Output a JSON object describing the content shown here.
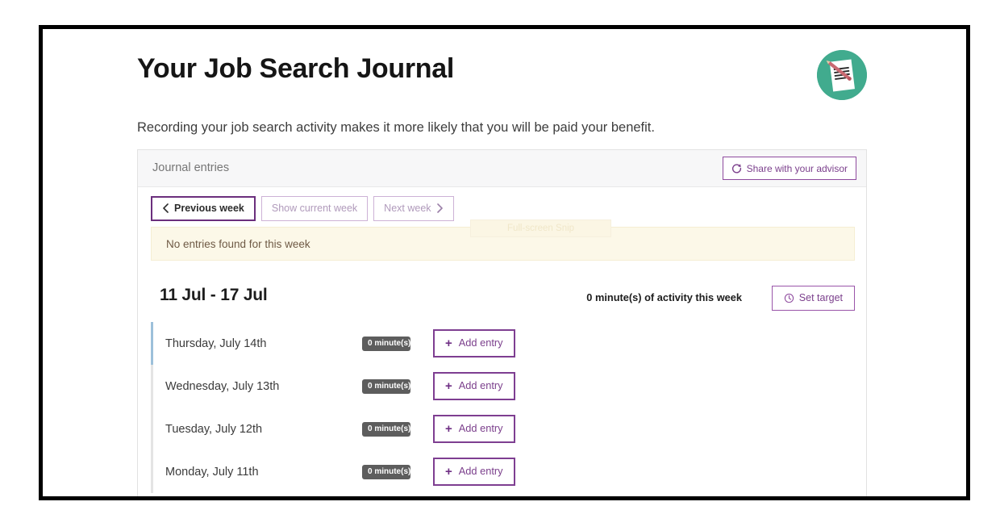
{
  "page": {
    "title": "Your Job Search Journal",
    "intro": "Recording your job search activity makes it more likely that you will be paid your benefit.",
    "logo_icon": "journal-notepad-pencil-icon",
    "logo_circle_color": "#41ab8e",
    "accent_color": "#7b3f8c"
  },
  "card": {
    "header_title": "Journal entries",
    "share_button": {
      "label": "Share with your advisor",
      "icon": "share-refresh-icon"
    },
    "week_nav": [
      {
        "label": "Previous week",
        "icon": "chevron-left-icon",
        "state": "active"
      },
      {
        "label": "Show current week",
        "icon": "",
        "state": "faded"
      },
      {
        "label": "Next week",
        "icon": "chevron-right-icon",
        "state": "faded"
      }
    ],
    "alert": {
      "text": "No entries found for this week",
      "background": "#fcf8e8"
    },
    "ghost_overlay_text": "Full-screen Snip",
    "week_summary": {
      "range": "11 Jul - 17 Jul",
      "total": "0 minute(s) of activity this week",
      "target_button": {
        "label": "Set target",
        "icon": "clock-icon"
      }
    },
    "add_entry_label": "Add entry",
    "add_entry_icon": "plus-icon",
    "days": [
      {
        "label": "Thursday, July 14th",
        "minutes": "0 minute(s)"
      },
      {
        "label": "Wednesday, July 13th",
        "minutes": "0 minute(s)"
      },
      {
        "label": "Tuesday, July 12th",
        "minutes": "0 minute(s)"
      },
      {
        "label": "Monday, July 11th",
        "minutes": "0 minute(s)"
      }
    ]
  }
}
